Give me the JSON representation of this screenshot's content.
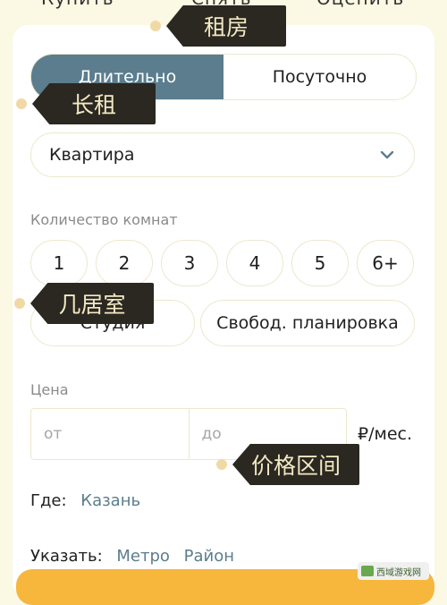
{
  "deal_tabs": [
    "Купить",
    "Снять",
    "Оценить"
  ],
  "rent_type": {
    "options": [
      "Длительно",
      "Посуточно"
    ],
    "selected": "Длительно"
  },
  "property_type": {
    "value": "Квартира"
  },
  "rooms": {
    "label": "Количество комнат",
    "options": [
      "1",
      "2",
      "3",
      "4",
      "5",
      "6+"
    ],
    "extra_options": [
      "Студия",
      "Свобод. планировка"
    ]
  },
  "price": {
    "label": "Цена",
    "from_placeholder": "от",
    "to_placeholder": "до",
    "unit": "₽/мес."
  },
  "location": {
    "label": "Где:",
    "city": "Казань"
  },
  "specify": {
    "label": "Указать:",
    "metro": "Метро",
    "district": "Район"
  },
  "annotations": {
    "rent": "租房",
    "long_term": "长租",
    "rooms": "几居室",
    "price_range": "价格区间"
  },
  "watermark": {
    "text": "西域游戏网"
  },
  "colors": {
    "accent": "#5b7d8e",
    "cta": "#f6b73c",
    "background": "#fbf8e4",
    "tag": "#2b2721"
  }
}
